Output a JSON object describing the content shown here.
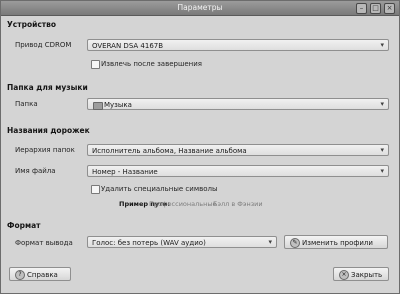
{
  "window": {
    "title": "Параметры"
  },
  "device": {
    "section_title": "Устройство",
    "drive_label": "Привод CDROM",
    "drive_value": "OVERAN DSA 4167B",
    "eject_label": "Извлечь после завершения",
    "eject_checked": false
  },
  "music_folder": {
    "section_title": "Папка для музыки",
    "folder_label": "Папка",
    "folder_value": "Музыка"
  },
  "track_names": {
    "section_title": "Названия дорожек",
    "folder_hierarchy_label": "Иерархия папок",
    "folder_hierarchy_value": "Исполнитель альбома, Название альбома",
    "file_name_label": "Имя файла",
    "file_name_value": "Номер - Название",
    "strip_label": "Удалить специальные символы",
    "strip_checked": false,
    "sample_path_label": "Пример пути:",
    "sample_path_folder": "Профессиональные",
    "sample_path_file": "Бэлл в Фэнзии"
  },
  "format": {
    "section_title": "Формат",
    "output_format_label": "Формат вывода",
    "output_format_value": "Голос: без потерь (WAV аудио)",
    "edit_profiles_label": "Изменить профили"
  },
  "buttons": {
    "help_label": "Справка",
    "close_label": "Закрыть"
  }
}
